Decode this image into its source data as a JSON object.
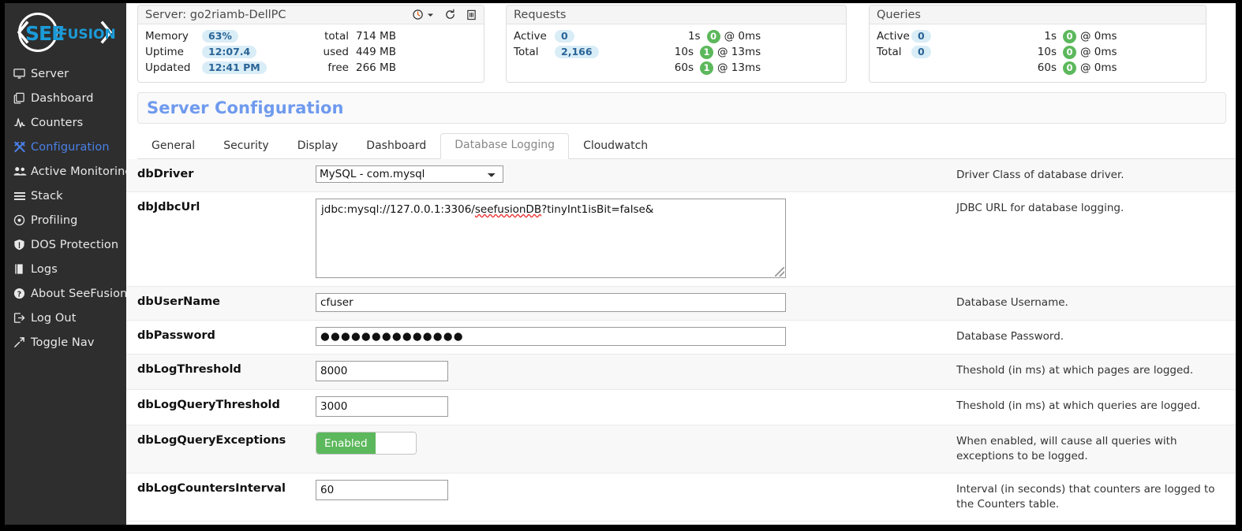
{
  "brand": {
    "logo_text_1": "SEE",
    "logo_text_2": "FUSION"
  },
  "sidebar": {
    "items": [
      {
        "label": "Server",
        "icon": "monitor-icon",
        "active": false
      },
      {
        "label": "Dashboard",
        "icon": "copy-icon",
        "active": false
      },
      {
        "label": "Counters",
        "icon": "pulse-icon",
        "active": false
      },
      {
        "label": "Configuration",
        "icon": "wrench-icon",
        "active": true
      },
      {
        "label": "Active Monitoring",
        "icon": "users-icon",
        "active": false
      },
      {
        "label": "Stack",
        "icon": "list-icon",
        "active": false
      },
      {
        "label": "Profiling",
        "icon": "target-icon",
        "active": false
      },
      {
        "label": "DOS Protection",
        "icon": "shield-icon",
        "active": false
      },
      {
        "label": "Logs",
        "icon": "book-icon",
        "active": false
      },
      {
        "label": "About SeeFusion",
        "icon": "question-icon",
        "active": false
      },
      {
        "label": "Log Out",
        "icon": "logout-icon",
        "active": false
      },
      {
        "label": "Toggle Nav",
        "icon": "expand-icon",
        "active": false
      }
    ]
  },
  "cards": {
    "server": {
      "title": "Server: go2riamb-DellPC",
      "icons": [
        "clock-dropdown-icon",
        "refresh-icon",
        "trash-icon"
      ],
      "rows": [
        {
          "key": "Memory",
          "pill": "63%"
        },
        {
          "key": "Uptime",
          "pill": "12:07.4"
        },
        {
          "key": "Updated",
          "pill": "12:41 PM"
        }
      ],
      "totals": [
        {
          "label": "total",
          "value": "714 MB"
        },
        {
          "label": "used",
          "value": "449 MB"
        },
        {
          "label": "free",
          "value": "266 MB"
        }
      ]
    },
    "requests": {
      "title": "Requests",
      "left": [
        {
          "key": "Active",
          "pill": "0"
        },
        {
          "key": "Total",
          "pill": "2,166"
        }
      ],
      "right": [
        {
          "sec": "1s",
          "count": "0",
          "at": "@ 0ms"
        },
        {
          "sec": "10s",
          "count": "1",
          "at": "@ 13ms"
        },
        {
          "sec": "60s",
          "count": "1",
          "at": "@ 13ms"
        }
      ]
    },
    "queries": {
      "title": "Queries",
      "left": [
        {
          "key": "Active",
          "pill": "0"
        },
        {
          "key": "Total",
          "pill": "0"
        }
      ],
      "right": [
        {
          "sec": "1s",
          "count": "0",
          "at": "@ 0ms"
        },
        {
          "sec": "10s",
          "count": "0",
          "at": "@ 0ms"
        },
        {
          "sec": "60s",
          "count": "0",
          "at": "@ 0ms"
        }
      ]
    }
  },
  "page": {
    "title": "Server Configuration",
    "tabs": [
      {
        "label": "General",
        "active": false
      },
      {
        "label": "Security",
        "active": false
      },
      {
        "label": "Display",
        "active": false
      },
      {
        "label": "Dashboard",
        "active": false
      },
      {
        "label": "Database Logging",
        "active": true
      },
      {
        "label": "Cloudwatch",
        "active": false
      }
    ]
  },
  "config_rows": [
    {
      "label": "dbDriver",
      "type": "select",
      "value": "MySQL - com.mysql",
      "desc": "Driver Class of database driver."
    },
    {
      "label": "dbJdbcUrl",
      "type": "textarea",
      "value_prefix": "jdbc:mysql://127.0.0.1:3306/",
      "value_misspelled": "seefusionDB",
      "value_suffix": "?tinyInt1isBit=false&",
      "desc": "JDBC URL for database logging."
    },
    {
      "label": "dbUserName",
      "type": "text-wide",
      "value": "cfuser",
      "desc": "Database Username."
    },
    {
      "label": "dbPassword",
      "type": "password",
      "value": "●●●●●●●●●●●●●●",
      "desc": "Database Password."
    },
    {
      "label": "dbLogThreshold",
      "type": "text-small",
      "value": "8000",
      "desc": "Theshold (in ms) at which pages are logged."
    },
    {
      "label": "dbLogQueryThreshold",
      "type": "text-small",
      "value": "3000",
      "desc": "Theshold (in ms) at which queries are logged."
    },
    {
      "label": "dbLogQueryExceptions",
      "type": "toggle",
      "value": "Enabled",
      "desc": "When enabled, will cause all queries with exceptions to be logged."
    },
    {
      "label": "dbLogCountersInterval",
      "type": "text-small",
      "value": "60",
      "desc": "Interval (in seconds) that counters are logged to the Counters table."
    }
  ],
  "colors": {
    "sidebar_bg": "#2e2e2e",
    "accent_blue": "#4a80e8",
    "title_blue": "#6f9aee",
    "badge_green": "#5cb85c",
    "pill_blue_bg": "#d9edf7",
    "pill_blue_fg": "#2a6496",
    "logo_blue": "#1b9bd8"
  }
}
